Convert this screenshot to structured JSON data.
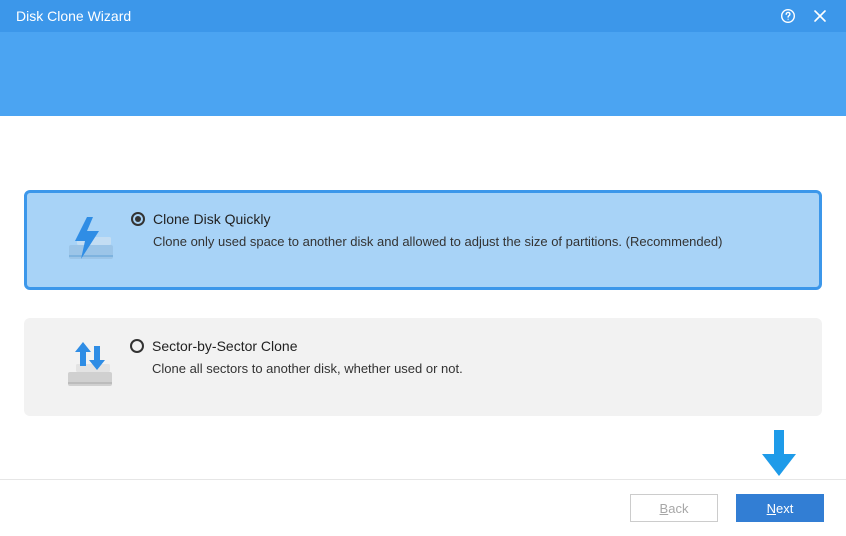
{
  "header": {
    "title": "Disk Clone Wizard",
    "help_icon": "help-icon",
    "close_icon": "close-icon"
  },
  "options": [
    {
      "id": "clone-quick",
      "icon": "disk-lightning-icon",
      "selected": true,
      "title": "Clone Disk Quickly",
      "description": "Clone only used space to another disk and allowed to adjust the size of partitions. (Recommended)"
    },
    {
      "id": "sector-by-sector",
      "icon": "disk-transfer-icon",
      "selected": false,
      "title": "Sector-by-Sector Clone",
      "description": "Clone all sectors to another disk, whether used or not."
    }
  ],
  "footer": {
    "back_mnemonic": "B",
    "back_rest": "ack",
    "next_mnemonic": "N",
    "next_rest": "ext"
  },
  "colors": {
    "accent": "#3c97ea",
    "primary_button": "#327ed4",
    "banner": "#4ba4f2"
  }
}
